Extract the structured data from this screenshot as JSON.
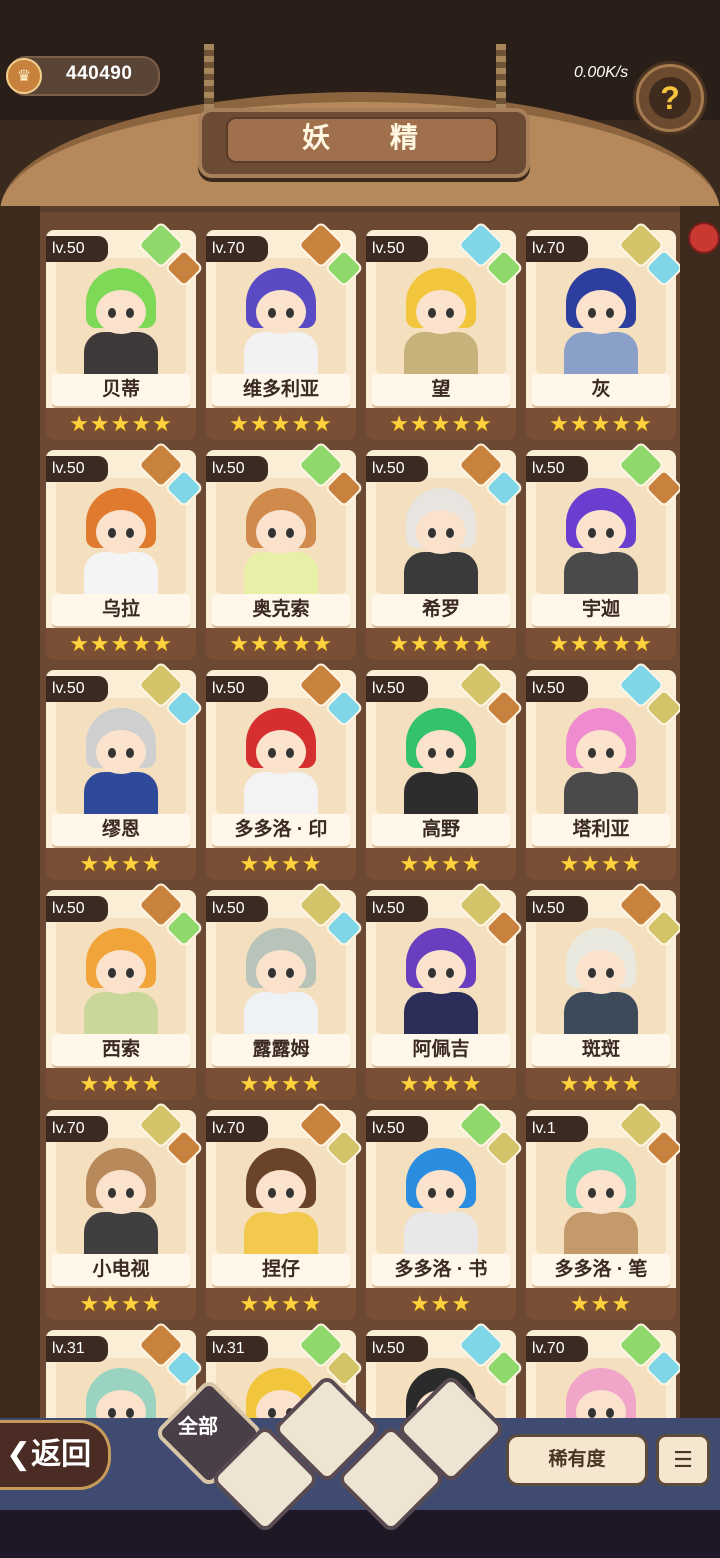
{
  "header": {
    "currency_value": "440490",
    "rate": "0.00K/s",
    "title": "妖 精",
    "help_glyph": "?"
  },
  "cards": [
    {
      "level": "lv.50",
      "name": "贝蒂",
      "stars": "★★★★★",
      "hair": "#7ed957",
      "body": "#3e3a3a"
    },
    {
      "level": "lv.70",
      "name": "维多利亚",
      "stars": "★★★★★",
      "hair": "#5a4bc4",
      "body": "#f2f2f2"
    },
    {
      "level": "lv.50",
      "name": "望",
      "stars": "★★★★★",
      "hair": "#f1c53c",
      "body": "#c6b27a"
    },
    {
      "level": "lv.70",
      "name": "灰",
      "stars": "★★★★★",
      "hair": "#2d3e9e",
      "body": "#8aa0c8"
    },
    {
      "level": "lv.50",
      "name": "乌拉",
      "stars": "★★★★★",
      "hair": "#e07a2e",
      "body": "#f4f4f4"
    },
    {
      "level": "lv.50",
      "name": "奥克索",
      "stars": "★★★★★",
      "hair": "#d08a4c",
      "body": "#e8f0a8"
    },
    {
      "level": "lv.50",
      "name": "希罗",
      "stars": "★★★★★",
      "hair": "#e8e4df",
      "body": "#3a3a3a"
    },
    {
      "level": "lv.50",
      "name": "宇迦",
      "stars": "★★★★★",
      "hair": "#6a3fcf",
      "body": "#4a4a4a"
    },
    {
      "level": "lv.50",
      "name": "缪恩",
      "stars": "★★★★",
      "hair": "#cfcfcf",
      "body": "#2f4a99"
    },
    {
      "level": "lv.50",
      "name": "多多洛 · 印",
      "stars": "★★★★",
      "hair": "#d62f2f",
      "body": "#f3f3f3"
    },
    {
      "level": "lv.50",
      "name": "高野",
      "stars": "★★★★",
      "hair": "#35c26d",
      "body": "#2d2d2d"
    },
    {
      "level": "lv.50",
      "name": "塔利亚",
      "stars": "★★★★",
      "hair": "#ef8ccf",
      "body": "#4a4a4a"
    },
    {
      "level": "lv.50",
      "name": "西索",
      "stars": "★★★★",
      "hair": "#f0a43a",
      "body": "#c9d89a"
    },
    {
      "level": "lv.50",
      "name": "露露姆",
      "stars": "★★★★",
      "hair": "#b8c4b9",
      "body": "#eef2f4"
    },
    {
      "level": "lv.50",
      "name": "阿佩吉",
      "stars": "★★★★",
      "hair": "#6a3fbf",
      "body": "#2d2d5a"
    },
    {
      "level": "lv.50",
      "name": "斑斑",
      "stars": "★★★★",
      "hair": "#e9e9e0",
      "body": "#3c4a5a"
    },
    {
      "level": "lv.70",
      "name": "小电视",
      "stars": "★★★★",
      "hair": "#b8895a",
      "body": "#3f3f3f"
    },
    {
      "level": "lv.70",
      "name": "捏仔",
      "stars": "★★★★",
      "hair": "#6b4328",
      "body": "#f2c94c"
    },
    {
      "level": "lv.50",
      "name": "多多洛 · 书",
      "stars": "★★★",
      "hair": "#2b8de0",
      "body": "#e8e8e8"
    },
    {
      "level": "lv.1",
      "name": "多多洛 · 笔",
      "stars": "★★★",
      "hair": "#7fdcb8",
      "body": "#c49a6c"
    },
    {
      "level": "lv.31",
      "name": "",
      "stars": "",
      "hair": "#9bd3c1",
      "body": "#d9d9d9"
    },
    {
      "level": "lv.31",
      "name": "",
      "stars": "",
      "hair": "#f1c53c",
      "body": "#d9d9d9"
    },
    {
      "level": "lv.50",
      "name": "",
      "stars": "",
      "hair": "#2b2b2b",
      "body": "#d9d9d9"
    },
    {
      "level": "lv.70",
      "name": "",
      "stars": "",
      "hair": "#f1a5c9",
      "body": "#d9d9d9"
    }
  ],
  "footer": {
    "back_label": "❮返回",
    "filter_all": "全部",
    "rarity_label": "稀有度",
    "sort_glyph": "☰"
  }
}
